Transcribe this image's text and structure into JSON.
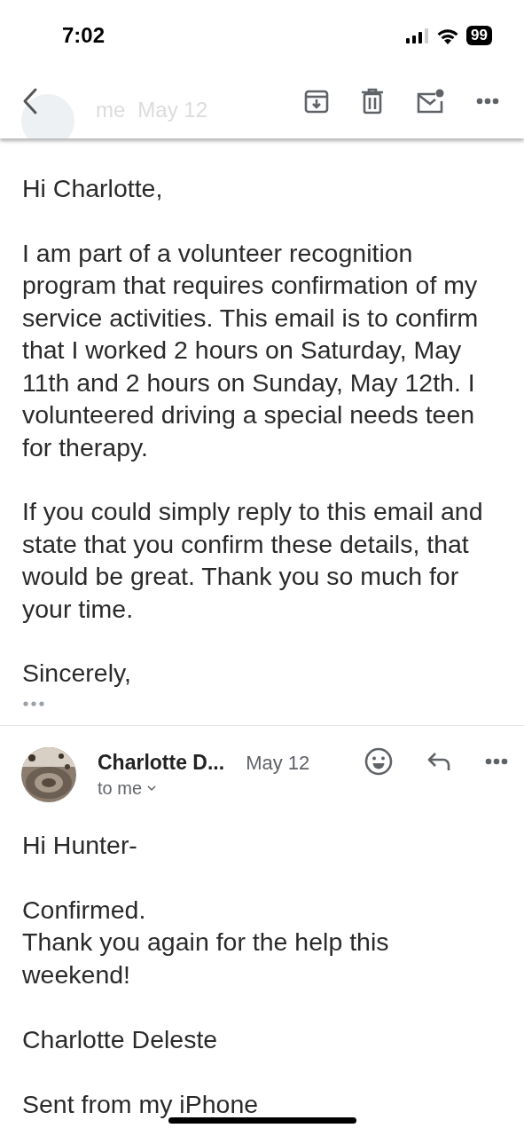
{
  "status_bar": {
    "time": "7:02",
    "battery": "99"
  },
  "behind_header": {
    "sender": "me",
    "date": "May 12"
  },
  "first_message": {
    "greeting": "Hi Charlotte,",
    "paragraphs": [
      "I am part of a volunteer recognition program that requires confirmation of my service activities. This email is to confirm that I worked 2 hours on Saturday, May 11th and 2 hours on Sunday, May 12th. I volunteered driving a special needs teen for therapy.",
      "If you could simply reply to this email and state that you confirm these details, that would be great. Thank you so much for your time.",
      "Sincerely,"
    ]
  },
  "reply": {
    "sender": "Charlotte D...",
    "date": "May 12",
    "recipient": "to me",
    "paragraphs": [
      [
        "Hi Hunter-"
      ],
      [
        "Confirmed.",
        "Thank you again for the help this weekend!"
      ],
      [
        "Charlotte Deleste"
      ],
      [
        "Sent from my iPhone"
      ]
    ]
  }
}
